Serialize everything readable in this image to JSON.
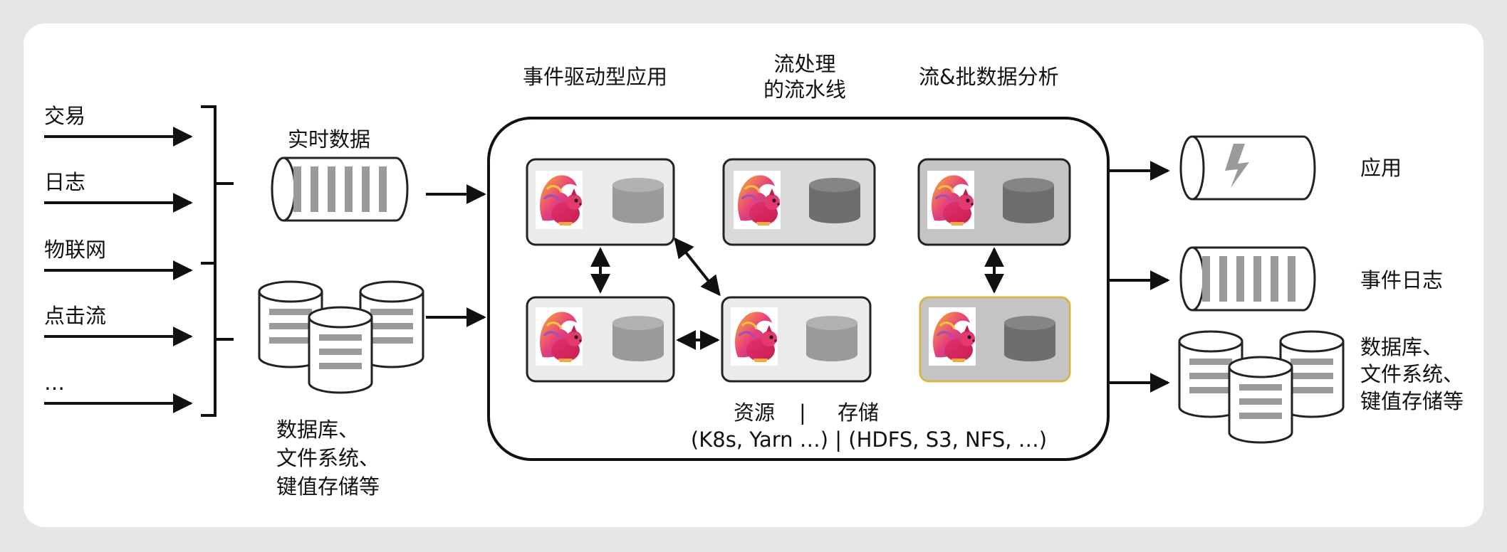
{
  "sources": [
    "交易",
    "日志",
    "物联网",
    "点击流",
    "…"
  ],
  "input": {
    "realtime_label": "实时数据",
    "db_label": [
      "数据库、",
      "文件系统、",
      "键值存储等"
    ]
  },
  "categories": {
    "event_driven": "事件驱动型应用",
    "pipeline": [
      "流处理",
      "的流水线"
    ],
    "analytics": "流&批数据分析"
  },
  "footer": {
    "line1_resources": "资源",
    "line1_sep": "|",
    "line1_storage": "存储",
    "line2": "(K8s, Yarn …) | (HDFS, S3, NFS, …)"
  },
  "outputs": {
    "app": "应用",
    "event_log": "事件日志",
    "db": [
      "数据库、",
      "文件系统、",
      "键值存储等"
    ]
  },
  "colors": {
    "background": "#e6e6e6",
    "panel": "#ffffff",
    "node_light": "#ebebeb",
    "node_mid": "#dadada",
    "node_dark": "#c4c4c4",
    "highlight_border": "#d6b64a",
    "drum": "#9a9a9a",
    "drum_dark": "#6e6e6e"
  },
  "icons": [
    "flink-squirrel-icon",
    "state-storage-icon",
    "lightning-icon"
  ]
}
